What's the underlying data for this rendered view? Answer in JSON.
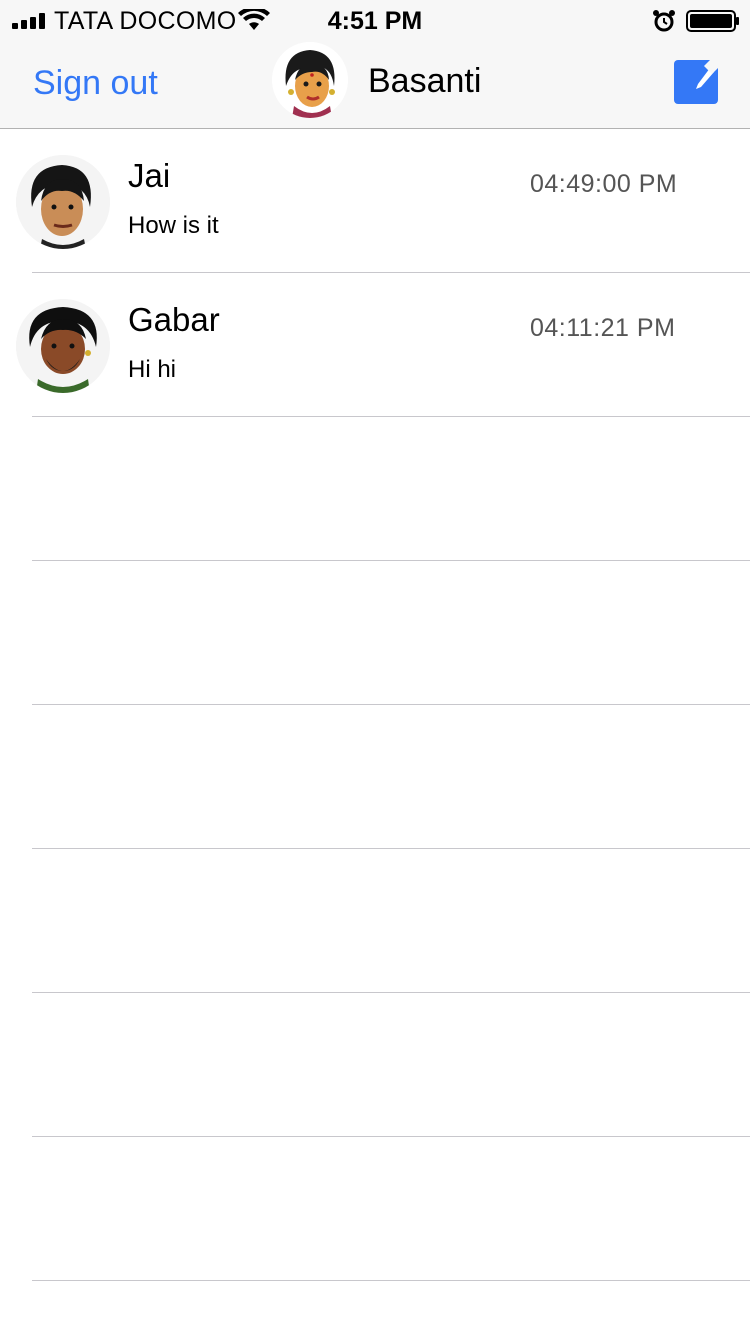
{
  "status_bar": {
    "carrier": "TATA DOCOMO",
    "time": "4:51 PM",
    "icons": [
      "signal-icon",
      "wifi-icon",
      "alarm-icon",
      "battery-icon"
    ]
  },
  "nav": {
    "sign_out_label": "Sign out",
    "title": "Basanti",
    "avatar_icon": "user-avatar",
    "compose_icon": "compose-icon",
    "accent_color": "#3478f6"
  },
  "chats": [
    {
      "name": "Jai",
      "message": "How is it",
      "time": "04:49:00 PM",
      "avatar_icon": "jai-avatar"
    },
    {
      "name": "Gabar",
      "message": "Hi hi",
      "time": "04:11:21 PM",
      "avatar_icon": "gabar-avatar"
    }
  ]
}
